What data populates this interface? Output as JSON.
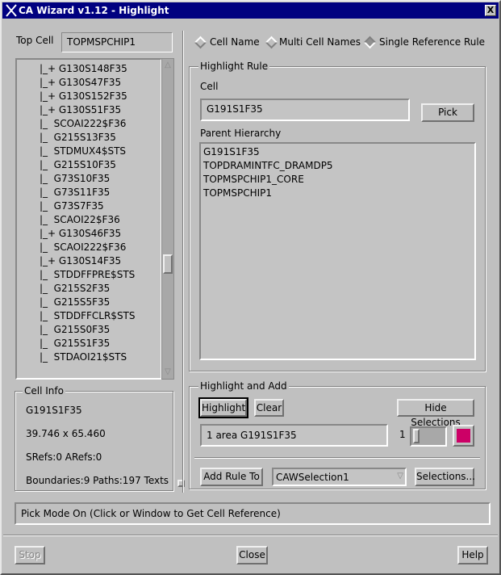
{
  "window": {
    "title": "CA Wizard v1.12 - Highlight",
    "close": "X"
  },
  "top_cell": {
    "label": "Top Cell",
    "value": "TOPMSPCHIP1"
  },
  "tree": {
    "items": [
      "|_+ G130S148F35",
      "|_+ G130S47F35",
      "|_+ G130S152F35",
      "|_+ G130S51F35",
      "|_  SCOAI222$F36",
      "|_  G215S13F35",
      "|_  STDMUX4$STS",
      "|_  G215S10F35",
      "|_  G73S10F35",
      "|_  G73S11F35",
      "|_  G73S7F35",
      "|_  SCAOI22$F36",
      "|_+ G130S46F35",
      "|_  SCAOI222$F36",
      "|_+ G130S14F35",
      "|_  STDDFFPRE$STS",
      "|_  G215S2F35",
      "|_  G215S5F35",
      "|_  STDDFFCLR$STS",
      "|_  G215S0F35",
      "|_  G215S1F35",
      "|_  STDAOI21$STS"
    ]
  },
  "cell_info": {
    "title": "Cell Info",
    "name": "G191S1F35",
    "size": "39.746 x 65.460",
    "refs": "SRefs:0  ARefs:0",
    "stats": "Boundaries:9  Paths:197  Texts"
  },
  "mode": {
    "options": [
      {
        "label": "Cell Name",
        "selected": false
      },
      {
        "label": "Multi Cell Names",
        "selected": false
      },
      {
        "label": "Single Reference Rule",
        "selected": true
      }
    ]
  },
  "highlight_rule": {
    "title": "Highlight Rule",
    "cell_label": "Cell",
    "cell_value": "G191S1F35",
    "pick": "Pick",
    "parent_label": "Parent Hierarchy",
    "parents": [
      "G191S1F35",
      "TOPDRAMINTFC_DRAMDP5",
      "TOPMSPCHIP1_CORE",
      "TOPMSPCHIP1"
    ]
  },
  "highlight_add": {
    "title": "Highlight and Add",
    "highlight": "Highlight",
    "clear": "Clear",
    "hide": "Hide Selections",
    "result": "1 area G191S1F35",
    "layer": "1",
    "color": "#cc0066",
    "add_rule": "Add Rule To",
    "selection": "CAWSelection1",
    "selections": "Selections..."
  },
  "status": "Pick Mode On (Click or Window to Get Cell Reference)",
  "footer": {
    "stop": "Stop",
    "close": "Close",
    "help": "Help"
  }
}
